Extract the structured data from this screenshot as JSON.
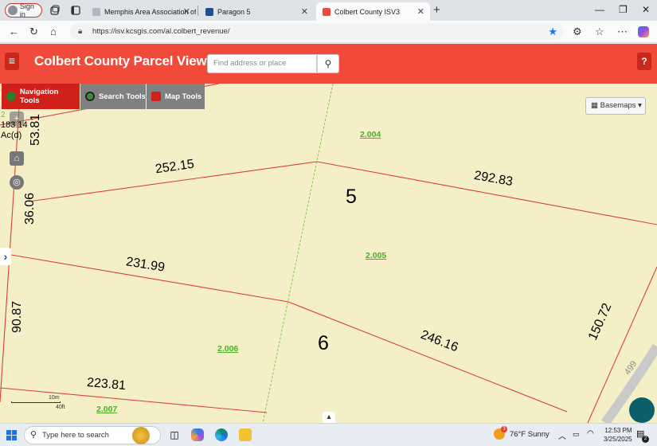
{
  "browser": {
    "signin_label": "Sign in",
    "tabs": [
      {
        "title": "Memphis Area Association of REAL",
        "favicon_color": "#b0b7c3"
      },
      {
        "title": "Paragon 5",
        "favicon_color": "#1e4f8f"
      },
      {
        "title": "Colbert County ISV3",
        "favicon_color": "#f04a3b",
        "active": true
      }
    ],
    "new_tab_label": "+",
    "url": "https://isv.kcsgis.com/al.colbert_revenue/"
  },
  "app": {
    "title": "Colbert County Parcel Viewer",
    "search_placeholder": "Find address or place",
    "accent_color": "#f04a3b",
    "toolbar": [
      {
        "label": "Navigation Tools",
        "icon": "globe-icon",
        "bg": "#d0201a"
      },
      {
        "label": "Search Tools",
        "icon": "search-tools-icon",
        "bg": "#808080"
      },
      {
        "label": "Map Tools",
        "icon": "map-icon",
        "bg": "#808080"
      }
    ],
    "basemaps_label": "Basemaps",
    "zoom_label": "2"
  },
  "map": {
    "dimensions": [
      "183.14",
      "Ac(d)",
      "53.81",
      "36.06",
      "90.87",
      "252.15",
      "292.83",
      "231.99",
      "246.16",
      "150.72",
      "223.81"
    ],
    "parcel_numbers": [
      "5",
      "6"
    ],
    "parcel_ids": [
      "2.004",
      "2.005",
      "2.006",
      "2.007"
    ],
    "road_label": "499",
    "scale": {
      "top": "10m",
      "bottom": "40ft"
    }
  },
  "taskbar": {
    "search_placeholder": "Type here to search",
    "weather": "76°F  Sunny",
    "time": "12:53 PM",
    "date": "3/25/2025",
    "notification_count": "2",
    "weather_badge": "3"
  }
}
